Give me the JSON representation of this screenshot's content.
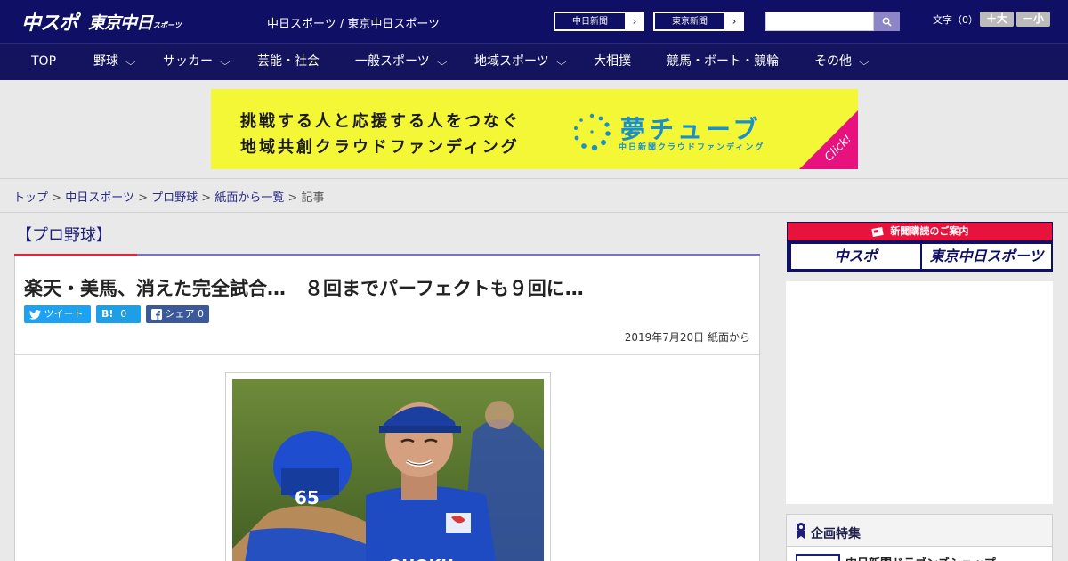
{
  "header": {
    "logo_main": "中スポ",
    "logo_tokyo": "東京中日",
    "logo_tokyo_sub": "スポーツ",
    "site_title": "中日スポーツ / 東京中日スポーツ",
    "paper_buttons": [
      {
        "label": "中日新聞",
        "arrow": "›"
      },
      {
        "label": "東京新聞",
        "arrow": "›"
      }
    ],
    "search_placeholder": "",
    "font_size_label": "文字（0）",
    "font_increase": "＋大",
    "font_decrease": "－小"
  },
  "nav": {
    "items": [
      {
        "label": "TOP",
        "has_dropdown": false
      },
      {
        "label": "野球",
        "has_dropdown": true
      },
      {
        "label": "サッカー",
        "has_dropdown": true
      },
      {
        "label": "芸能・社会",
        "has_dropdown": false
      },
      {
        "label": "一般スポーツ",
        "has_dropdown": true
      },
      {
        "label": "地域スポーツ",
        "has_dropdown": true
      },
      {
        "label": "大相撲",
        "has_dropdown": false
      },
      {
        "label": "競馬・ボート・競輪",
        "has_dropdown": false
      },
      {
        "label": "その他",
        "has_dropdown": true
      }
    ],
    "chevron": "⌵"
  },
  "ad_banner": {
    "line1": "挑戦する人と応援する人をつなぐ",
    "line2": "地域共創クラウドファンディング",
    "brand": "夢チューブ",
    "brand_sub": "中日新聞クラウドファンディング",
    "click": "Click!",
    "colors": {
      "background": "#f4f736",
      "brand": "#1a8fc9",
      "corner": "#e8127e"
    }
  },
  "breadcrumb": {
    "items": [
      "トップ",
      "中日スポーツ",
      "プロ野球",
      "紙面から一覧"
    ],
    "separator": ">",
    "current": "記事"
  },
  "article": {
    "category": "【プロ野球】",
    "headline": "楽天・美馬、消えた完全試合…　８回までパーフェクトも９回に…",
    "share": {
      "tweet": "ツイート",
      "hatena_label": "B!",
      "hatena_count": "0",
      "facebook": "シェア",
      "facebook_count": "0"
    },
    "date": "2019年7月20日 紙面から"
  },
  "sidebar": {
    "subscription_head": "新聞購読のご案内",
    "subscription_buttons": [
      "中スポ",
      "東京中日スポーツ"
    ],
    "special_title": "企画特集",
    "special_item": "中日新聞ドラゴンズショップ"
  },
  "colors": {
    "header_bg": "#0f0f66",
    "nav_bg": "#14135e",
    "accent_red": "#e5243b",
    "accent_purple": "#7b72c2"
  }
}
